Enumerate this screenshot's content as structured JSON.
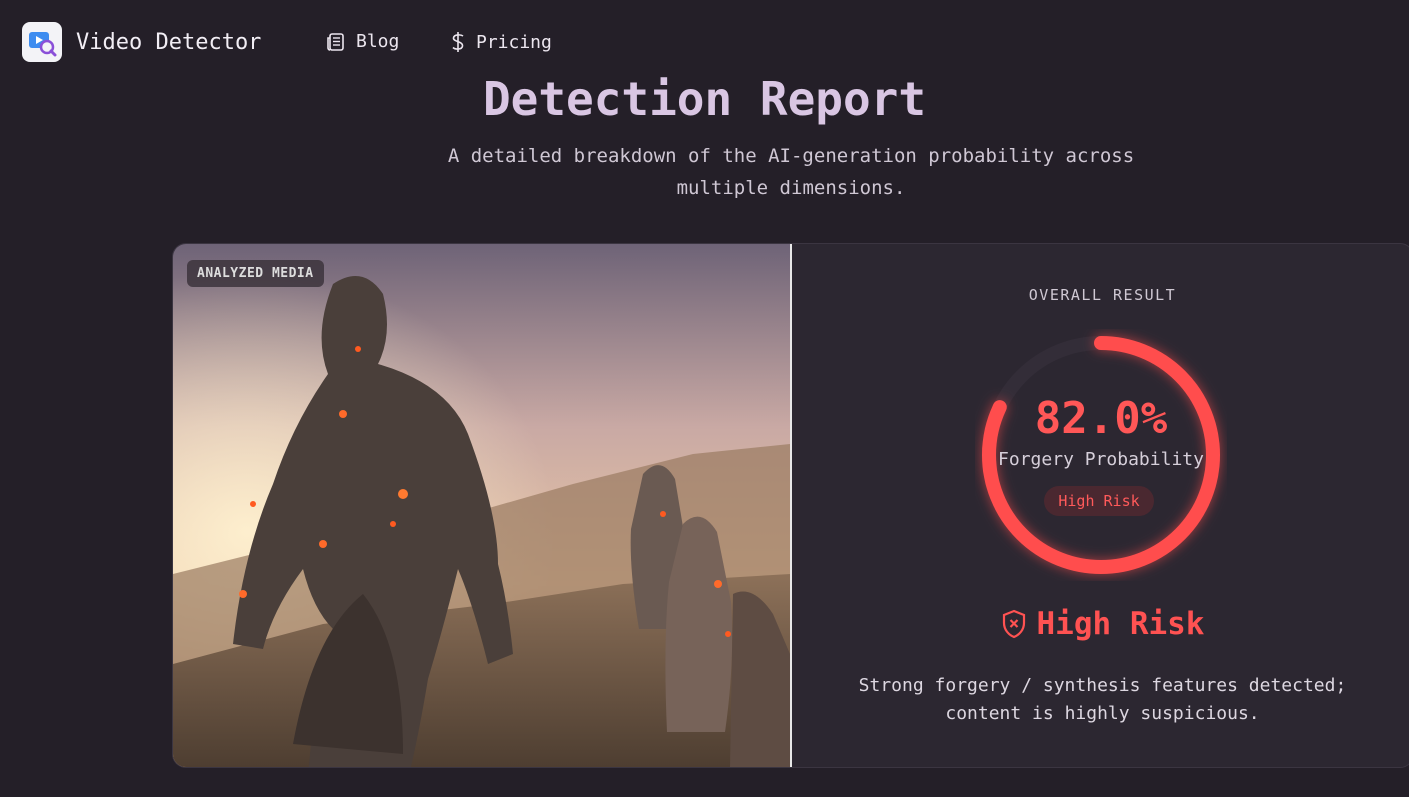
{
  "nav": {
    "brand": "Video Detector",
    "links": [
      {
        "label": "Blog",
        "icon": "newspaper-icon"
      },
      {
        "label": "Pricing",
        "icon": "dollar-icon"
      }
    ]
  },
  "header": {
    "title": "Detection Report",
    "subtitle": "A detailed breakdown of the AI-generation probability across multiple dimensions."
  },
  "media": {
    "tag": "ANALYZED MEDIA"
  },
  "result": {
    "heading": "OVERALL RESULT",
    "probability_text": "82.0%",
    "probability": 0.82,
    "probability_label": "Forgery Probability",
    "badge": "High Risk",
    "verdict": "High Risk",
    "description": "Strong forgery / synthesis features detected; content is highly suspicious."
  },
  "colors": {
    "accent": "#ff5252",
    "title": "#d9c6e3",
    "background": "#241f28",
    "card": "#2c2731"
  }
}
